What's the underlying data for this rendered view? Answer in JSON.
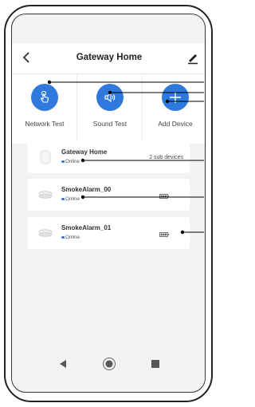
{
  "header": {
    "title": "Gateway Home",
    "back_icon": "chevron-left-icon",
    "edit_icon": "pencil-icon"
  },
  "actions": [
    {
      "label": "Network Test",
      "icon": "hand-touch-icon"
    },
    {
      "label": "Sound Test",
      "icon": "speaker-icon"
    },
    {
      "label": "Add Device",
      "icon": "plus-icon"
    }
  ],
  "devices": [
    {
      "name": "Gateway Home",
      "status": "Online",
      "extra": "2 sub devices",
      "icon": "gateway-icon"
    },
    {
      "name": "SmokeAlarm_00",
      "status": "Online",
      "icon": "smoke-alarm-icon",
      "battery_icon": "battery-icon"
    },
    {
      "name": "SmokeAlarm_01",
      "status": "Online",
      "icon": "smoke-alarm-icon",
      "battery_icon": "battery-icon"
    }
  ],
  "navigation": {
    "back": "triangle-back-icon",
    "home": "circle-home-icon",
    "recent": "square-recent-icon"
  },
  "colors": {
    "accent": "#2f79dc",
    "background": "#f3f3f3",
    "card": "#ffffff",
    "callout": "#000000"
  }
}
